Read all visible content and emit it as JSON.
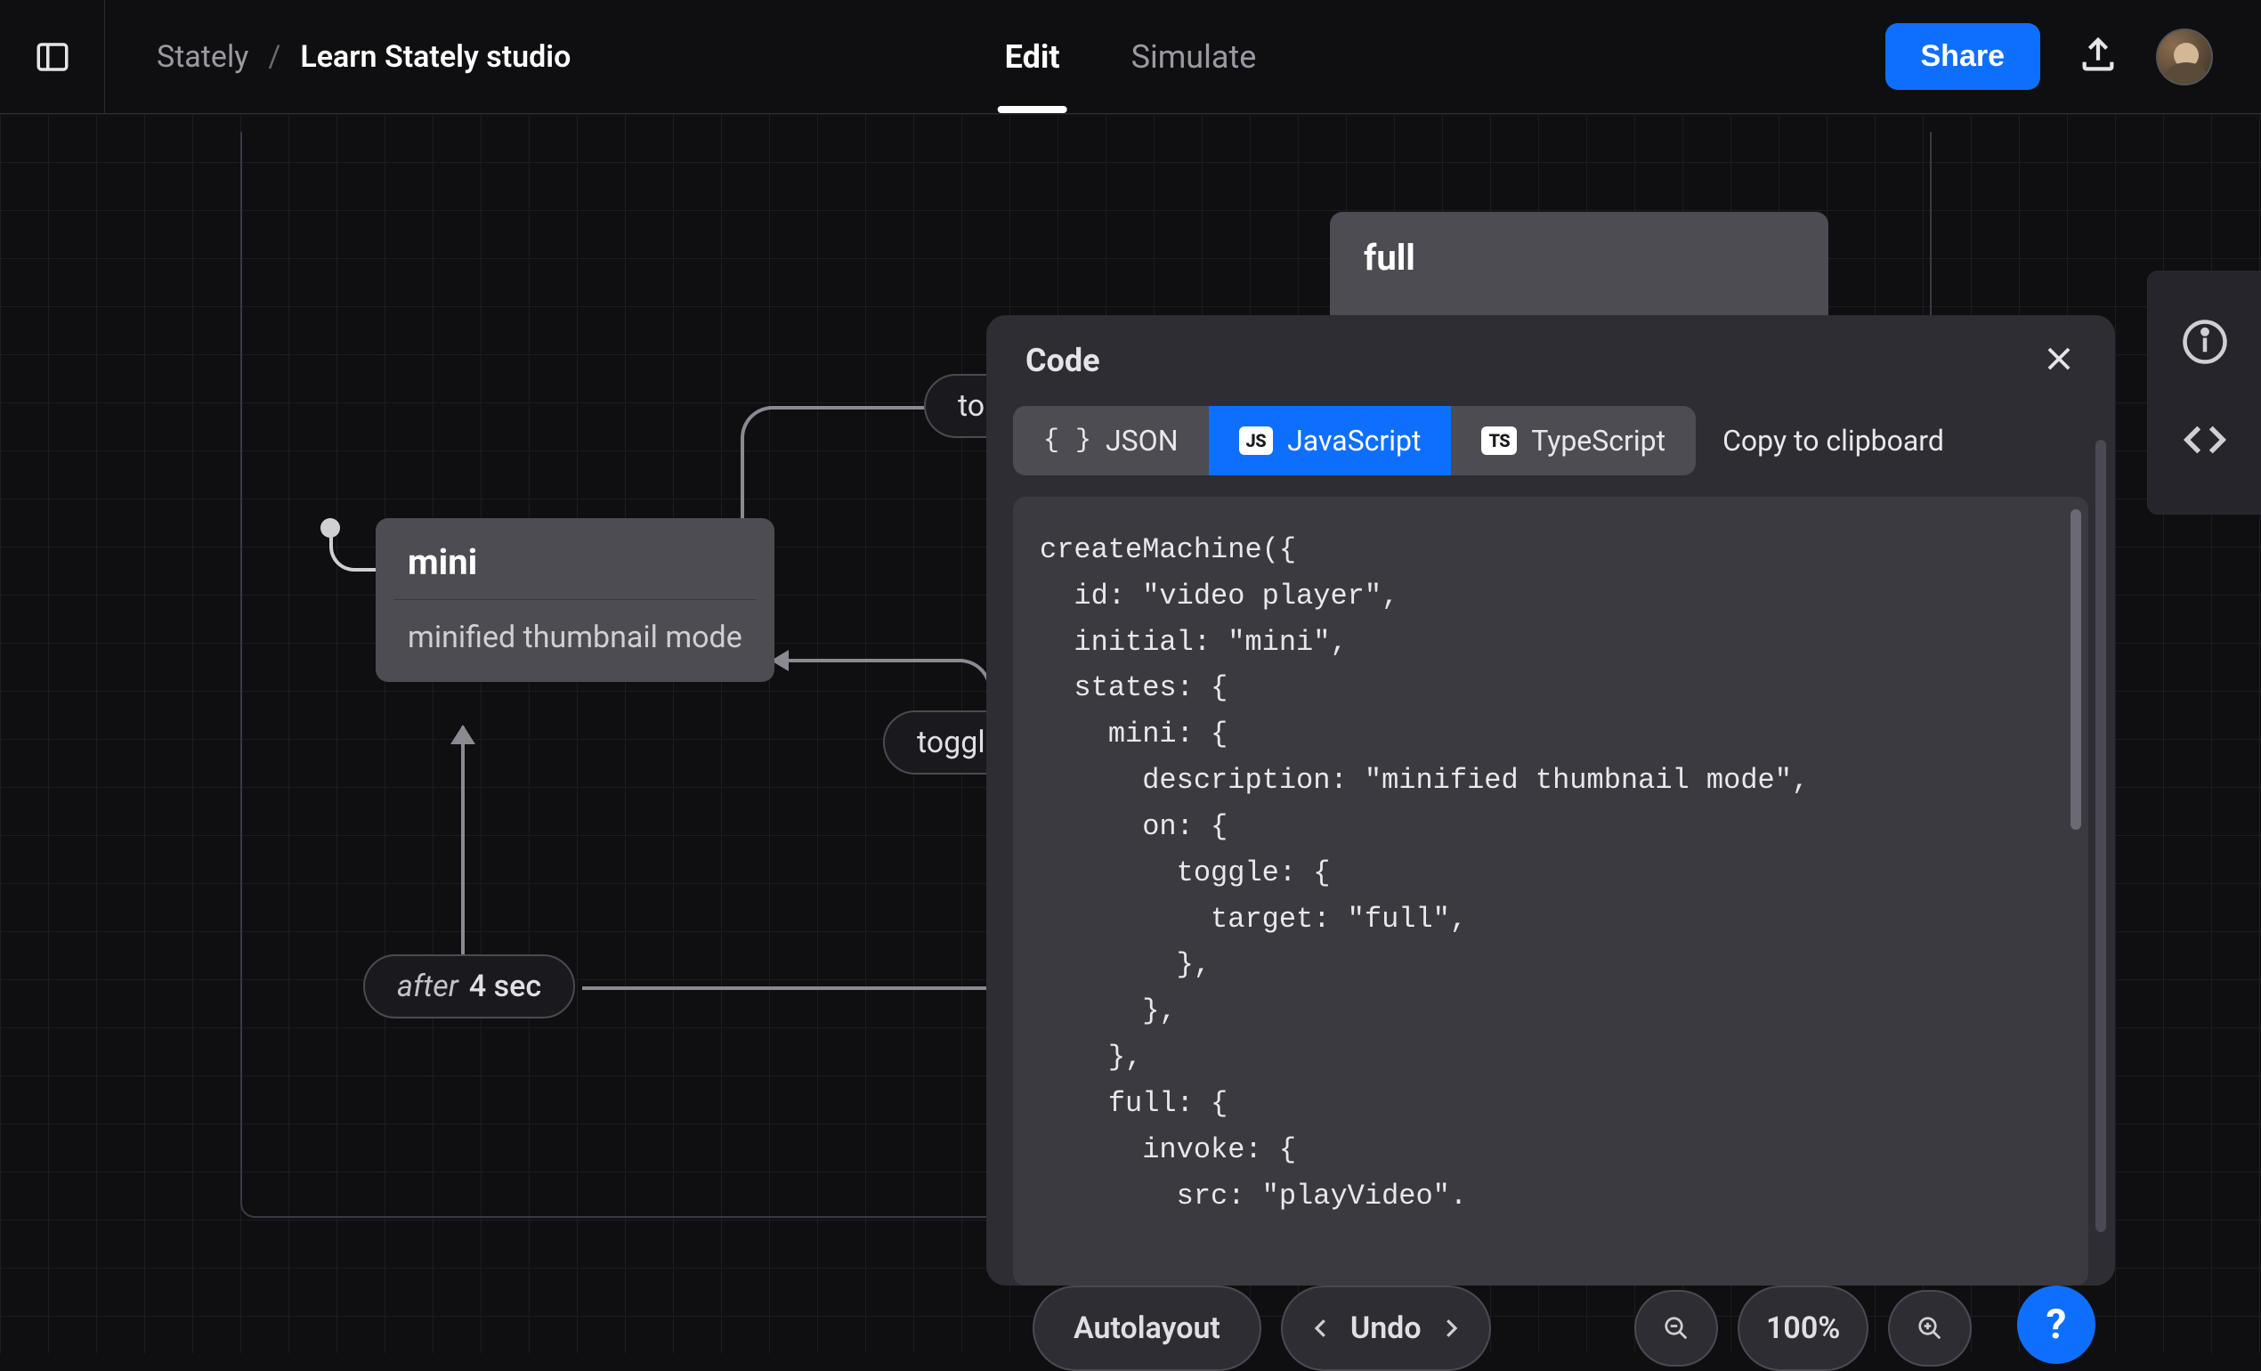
{
  "breadcrumb": {
    "org": "Stately",
    "sep": "/",
    "project": "Learn Stately studio"
  },
  "modes": {
    "edit": "Edit",
    "simulate": "Simulate",
    "active": "edit"
  },
  "topbar": {
    "share": "Share"
  },
  "states": {
    "full": {
      "title": "full"
    },
    "mini": {
      "title": "mini",
      "description": "minified thumbnail mode"
    }
  },
  "transitions": {
    "toggle_top": "to",
    "toggle_mid": "toggle",
    "after": {
      "word": "after",
      "time": "4 sec"
    }
  },
  "code_panel": {
    "title": "Code",
    "tabs": {
      "json": "JSON",
      "js": "JavaScript",
      "ts": "TypeScript",
      "active": "js"
    },
    "copy": "Copy to clipboard",
    "code": "createMachine({\n  id: \"video player\",\n  initial: \"mini\",\n  states: {\n    mini: {\n      description: \"minified thumbnail mode\",\n      on: {\n        toggle: {\n          target: \"full\",\n        },\n      },\n    },\n    full: {\n      invoke: {\n        src: \"playVideo\"."
  },
  "bottom": {
    "autolayout": "Autolayout",
    "undo": "Undo",
    "zoom": "100%",
    "help": "?"
  },
  "badges": {
    "js": "JS",
    "ts": "TS"
  },
  "icons": {
    "braces": "{ }"
  }
}
